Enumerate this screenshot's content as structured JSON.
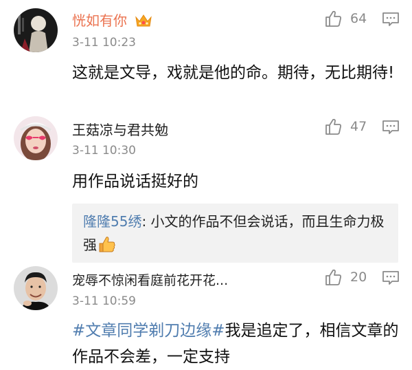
{
  "comments": [
    {
      "username": "恍如有你",
      "time": "3-11 10:23",
      "likes": "64",
      "text": "这就是文导，戏就是他的命。期待，无比期待!"
    },
    {
      "username": "王菇凉与君共勉",
      "time": "3-11 10:30",
      "likes": "47",
      "text": "用作品说话挺好的",
      "reply": {
        "user": "隆隆55绣",
        "text": ": 小文的作品不但会说话，而且生命力极强"
      }
    },
    {
      "username": "宠辱不惊闲看庭前花开花...",
      "time": "3-11 10:59",
      "likes": "20",
      "hashtag": "#文章同学剃刀边缘#",
      "text": "我是追定了，相信文章的作品不会差，一定支持"
    }
  ],
  "colors": {
    "vip_name": "#eb7350",
    "link": "#507daf",
    "meta": "#8a8a8a",
    "reply_bg": "#f2f2f2"
  }
}
